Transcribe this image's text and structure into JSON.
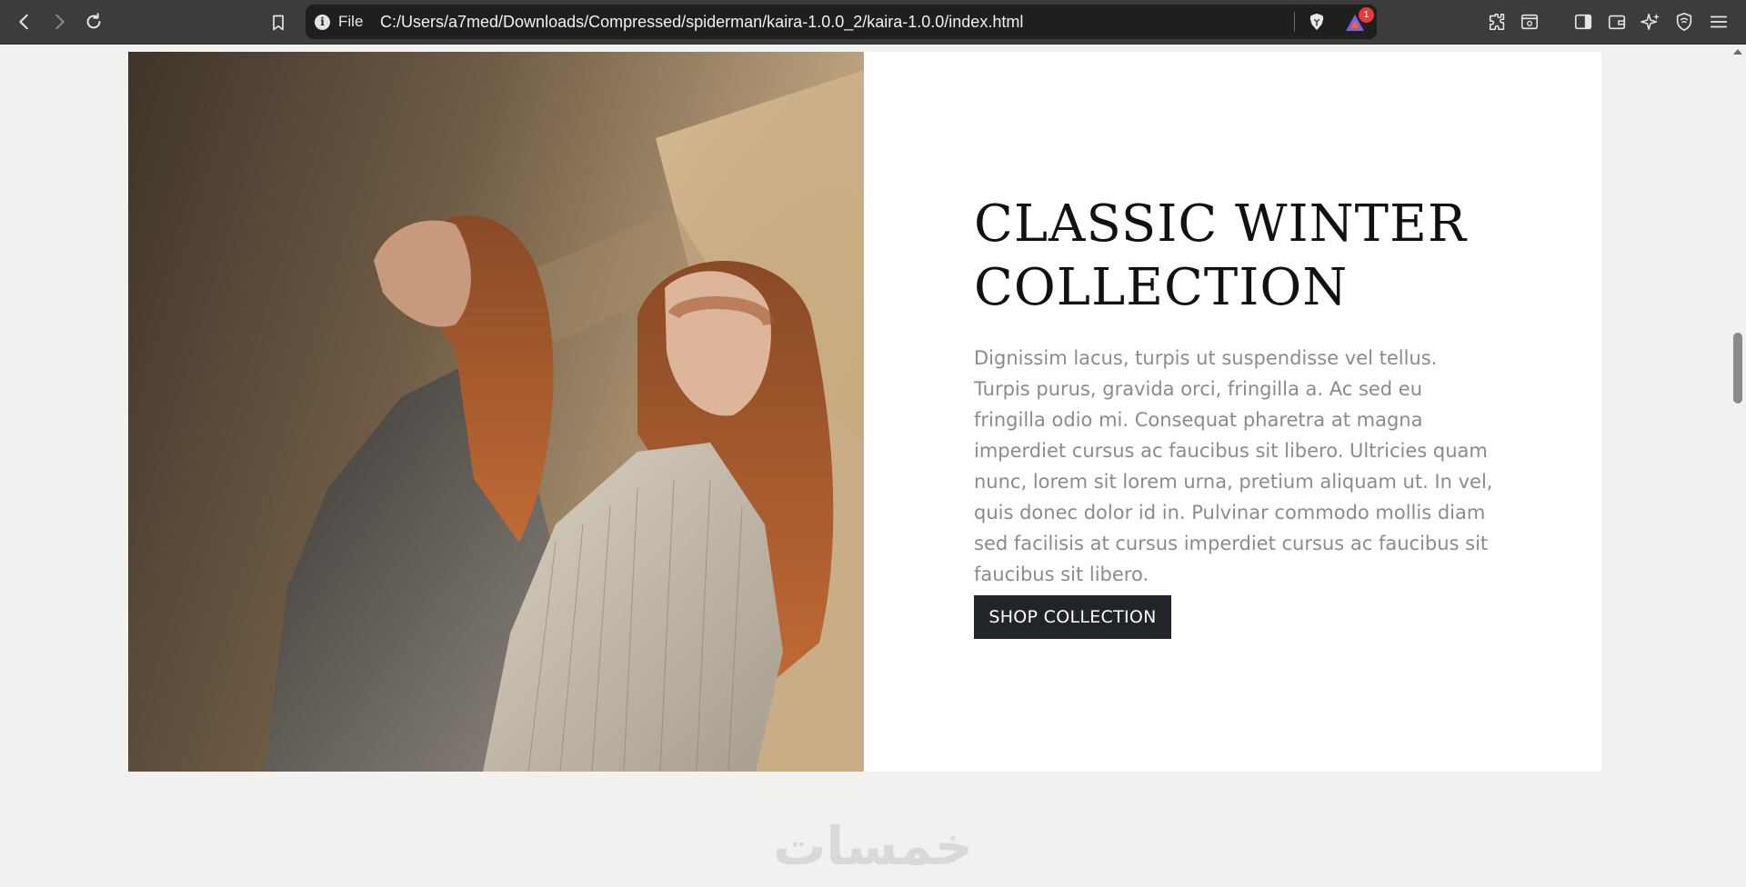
{
  "browser": {
    "scheme_label": "File",
    "url": "C:/Users/a7med/Downloads/Compressed/spiderman/kaira-1.0.0_2/kaira-1.0.0/index.html",
    "rewards_count": "1",
    "icons": [
      "back-icon",
      "forward-icon",
      "reload-icon",
      "bookmark-icon",
      "info-icon",
      "brave-shield-icon",
      "brave-rewards-icon",
      "extensions-icon",
      "reader-mode-icon",
      "sidebar-icon",
      "wallet-icon",
      "leo-ai-icon",
      "vpn-icon",
      "menu-icon"
    ]
  },
  "collection": {
    "title": "CLASSIC WINTER COLLECTION",
    "description": "Dignissim lacus, turpis ut suspendisse vel tellus. Turpis purus, gravida orci, fringilla a. Ac sed eu fringilla odio mi. Consequat pharetra at magna imperdiet cursus ac faucibus sit libero. Ultricies quam nunc, lorem sit lorem urna, pretium aliquam ut. In vel, quis donec dolor id in. Pulvinar commodo mollis diam sed facilisis at cursus imperdiet cursus ac faucibus sit faucibus sit libero.",
    "button_label": "SHOP COLLECTION",
    "image_alt": "Two models with long red hair in pinstripe blazers"
  },
  "watermark": {
    "text": "خمسات"
  }
}
